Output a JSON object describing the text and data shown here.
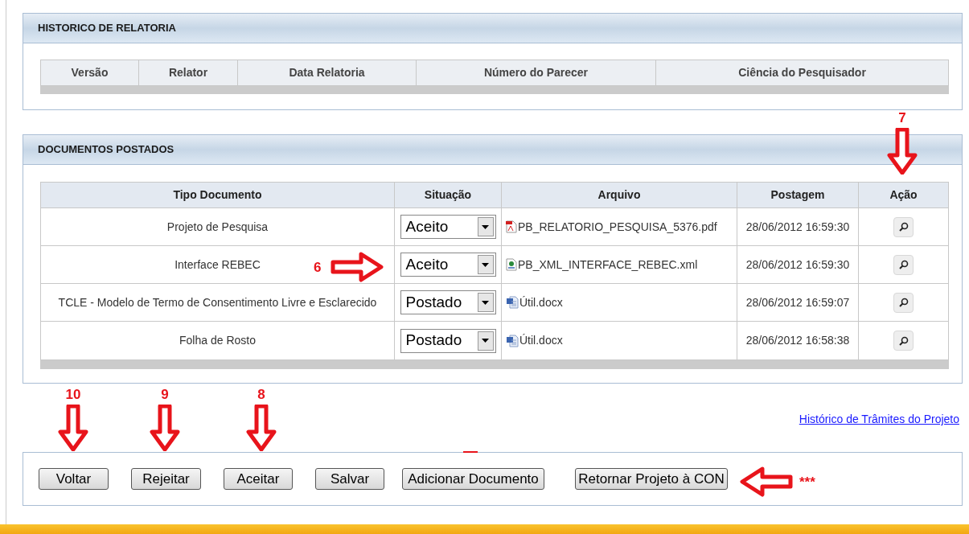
{
  "historico": {
    "title": "HISTORICO DE RELATORIA",
    "columns": [
      "Versão",
      "Relator",
      "Data Relatoria",
      "Número do Parecer",
      "Ciência do Pesquisador"
    ]
  },
  "documentos": {
    "title": "DOCUMENTOS POSTADOS",
    "columns": [
      "Tipo Documento",
      "Situação",
      "Arquivo",
      "Postagem",
      "Ação"
    ],
    "rows": [
      {
        "tipo": "Projeto de Pesquisa",
        "situacao": "Aceito",
        "arquivo": "PB_RELATORIO_PESQUISA_5376.pdf",
        "kind": "pdf",
        "postagem": "28/06/2012 16:59:30"
      },
      {
        "tipo": "Interface REBEC",
        "situacao": "Aceito",
        "arquivo": "PB_XML_INTERFACE_REBEC.xml",
        "kind": "xml",
        "postagem": "28/06/2012 16:59:30"
      },
      {
        "tipo": "TCLE - Modelo de Termo de Consentimento Livre e Esclarecido",
        "situacao": "Postado",
        "arquivo": "Útil.docx",
        "kind": "doc",
        "postagem": "28/06/2012 16:59:07"
      },
      {
        "tipo": "Folha de Rosto",
        "situacao": "Postado",
        "arquivo": "Útil.docx",
        "kind": "doc",
        "postagem": "28/06/2012 16:58:38"
      }
    ]
  },
  "link": "Histórico de Trâmites do Projeto",
  "buttons": [
    "Voltar",
    "Rejeitar",
    "Aceitar",
    "Salvar",
    "Adicionar Documento",
    "Retornar Projeto à CON"
  ],
  "annotations": [
    {
      "label": "7",
      "kind": "down"
    },
    {
      "label": "6",
      "kind": "right"
    },
    {
      "label": "10",
      "kind": "down"
    },
    {
      "label": "9",
      "kind": "down"
    },
    {
      "label": "8",
      "kind": "down"
    },
    {
      "label": "***",
      "kind": "left"
    }
  ]
}
